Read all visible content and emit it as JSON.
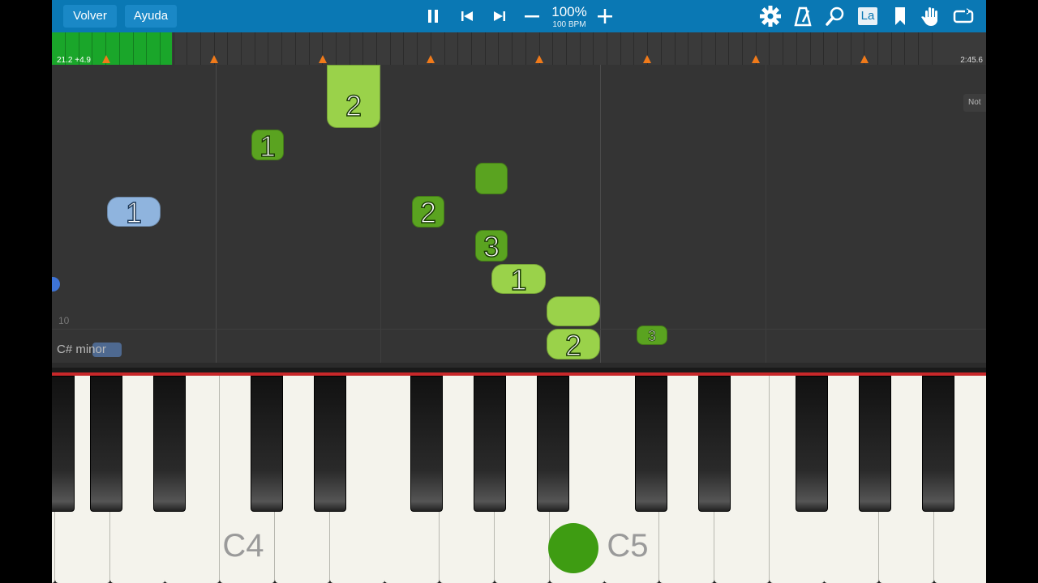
{
  "toolbar": {
    "back_label": "Volver",
    "help_label": "Ayuda",
    "zoom": "100%",
    "bpm": "100 BPM",
    "language_label": "La",
    "buttons": {
      "pause": "pause-icon",
      "previous": "skip-back-icon",
      "next": "skip-forward-icon",
      "zoom_out": "minus-icon",
      "zoom_in": "plus-icon",
      "settings": "gear-icon",
      "metronome": "metronome-icon",
      "search": "magnifier-icon",
      "bookmark": "bookmark-icon",
      "hand": "hand-icon",
      "loop": "loop-icon"
    }
  },
  "timeline": {
    "position_label": "21.2 +4.9",
    "end_label": "2:45.6",
    "progress_color": "#1aa62a",
    "marker_color": "#f07a1a"
  },
  "notes": {
    "measure_number": "10",
    "chord_label": "C# minor",
    "right_tab_label": "Not",
    "items": [
      {
        "finger": "2",
        "style": "light"
      },
      {
        "finger": "1",
        "style": "dark"
      },
      {
        "finger": "1",
        "style": "blue"
      },
      {
        "finger": "",
        "style": "dark"
      },
      {
        "finger": "2",
        "style": "dark"
      },
      {
        "finger": "3",
        "style": "dark"
      },
      {
        "finger": "1",
        "style": "light"
      },
      {
        "finger": "",
        "style": "light"
      },
      {
        "finger": "2",
        "style": "light"
      },
      {
        "finger": "3",
        "style": "dark"
      }
    ]
  },
  "keyboard": {
    "labels": {
      "c4": "C4",
      "c5": "C5"
    },
    "pressed_color": "#3e9c12"
  }
}
